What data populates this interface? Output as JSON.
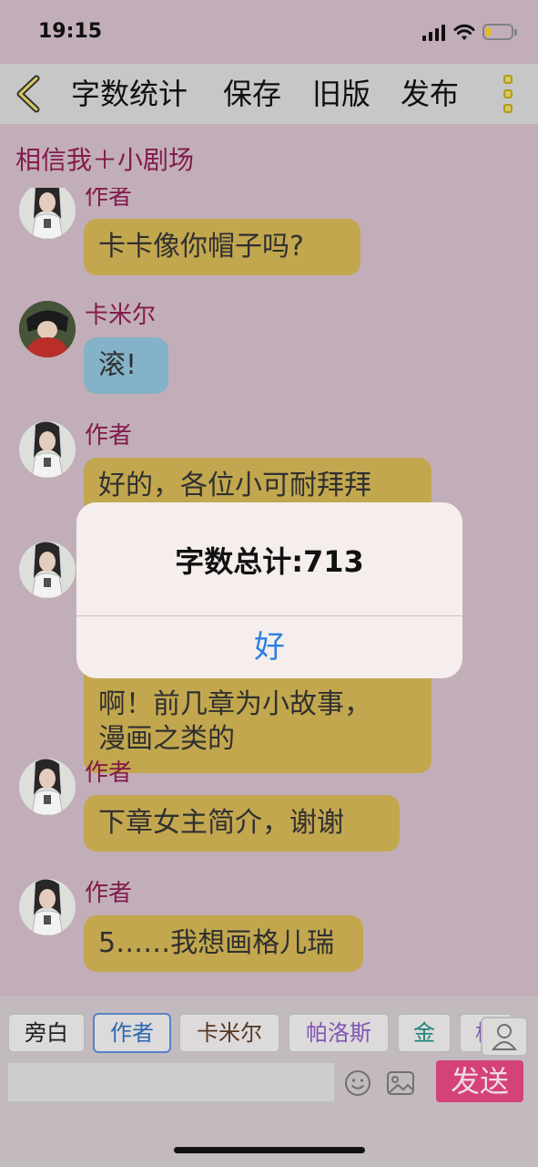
{
  "status_bar": {
    "time": "19:15",
    "battery_level": 0.2
  },
  "nav": {
    "word_count": "字数统计",
    "save": "保存",
    "old_version": "旧版",
    "publish": "发布"
  },
  "chat_title": "相信我＋小剧场",
  "messages": [
    {
      "speaker": "作者",
      "text": "卡卡像你帽子吗?",
      "color": "#cdb054"
    },
    {
      "speaker": "卡米尔",
      "text": "滚!",
      "color": "#8cbcd3"
    },
    {
      "speaker": "作者",
      "text": "好的，各位小可耐拜拜",
      "color": "#cdb054"
    },
    {
      "speaker": "",
      "text": "啊！前几章为小故事，",
      "color": "#cdb054"
    },
    {
      "speaker": "",
      "text": "漫画之类的",
      "color": "#cdb054"
    },
    {
      "speaker": "作者",
      "text": "下章女主简介，谢谢",
      "color": "#cdb054"
    },
    {
      "speaker": "作者",
      "text": "5……我想画格儿瑞",
      "color": "#cdb054"
    }
  ],
  "alert": {
    "title": "字数总计:713",
    "ok": "好"
  },
  "characters": [
    {
      "label": "旁白",
      "color": "#222222"
    },
    {
      "label": "作者",
      "color": "#2f6fba",
      "selected": true
    },
    {
      "label": "卡米尔",
      "color": "#5c3b22"
    },
    {
      "label": "帕洛斯",
      "color": "#8a5bbd"
    },
    {
      "label": "金",
      "color": "#1f8a84"
    },
    {
      "label": "格",
      "color": "#8a5bbd"
    }
  ],
  "composer": {
    "input_value": "",
    "send": "发送"
  },
  "icons": {
    "back": "chevron-left-icon",
    "more": "more-vertical-icon",
    "person": "person-icon",
    "emoji": "emoji-icon",
    "image": "image-icon"
  },
  "colors": {
    "accent": "#e0467f",
    "speaker": "#8a1d4f",
    "background": "#cdb8c3"
  }
}
